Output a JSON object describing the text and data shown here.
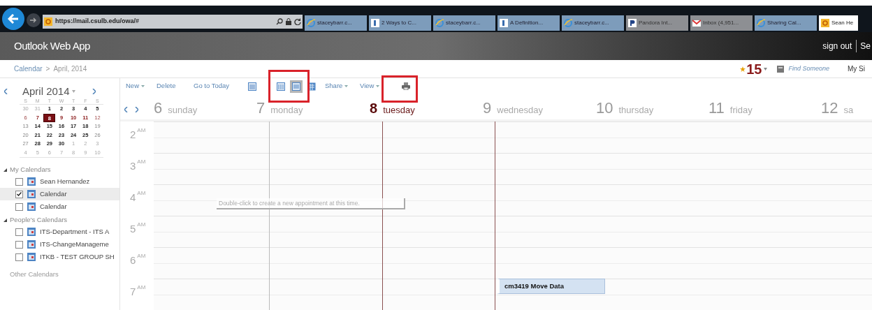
{
  "browser": {
    "address": "https://mail.csulb.edu/owa/#",
    "tabs": [
      {
        "label": "staceybarr.c...",
        "kind": "ie",
        "selected": false
      },
      {
        "label": "2 Ways to C...",
        "kind": "doc",
        "selected": false
      },
      {
        "label": "staceybarr.c...",
        "kind": "ie",
        "selected": false
      },
      {
        "label": "A Definition...",
        "kind": "doc",
        "selected": false
      },
      {
        "label": "staceybarr.c...",
        "kind": "ie",
        "selected": false
      },
      {
        "label": "Pandora Int...",
        "kind": "pandora",
        "selected": false
      },
      {
        "label": "Inbox (4,951...",
        "kind": "mail",
        "selected": false
      },
      {
        "label": "Sharing Cal...",
        "kind": "ie",
        "selected": false
      },
      {
        "label": "Sean He",
        "kind": "owa",
        "selected": true
      }
    ]
  },
  "app": {
    "title": "Outlook Web App",
    "sign_out": "sign out",
    "user": "Se"
  },
  "breadcrumb": {
    "root": "Calendar",
    "separator": ">",
    "current": "April, 2014"
  },
  "topbar": {
    "reminder_count": "15",
    "find_someone": "Find Someone",
    "my_site": "My Si"
  },
  "mini_calendar": {
    "title": "April 2014",
    "weekdays": [
      "S",
      "M",
      "T",
      "W",
      "T",
      "F",
      "S"
    ],
    "weeks": [
      [
        {
          "d": "30",
          "kind": "other"
        },
        {
          "d": "31",
          "kind": "other"
        },
        {
          "d": "1",
          "kind": "busy"
        },
        {
          "d": "2",
          "kind": "busy"
        },
        {
          "d": "3",
          "kind": "busy"
        },
        {
          "d": "4",
          "kind": "busy"
        },
        {
          "d": "5",
          "kind": "busy"
        }
      ],
      [
        {
          "d": "6",
          "kind": "weekfree"
        },
        {
          "d": "7",
          "kind": "weekbusy"
        },
        {
          "d": "8",
          "kind": "selected"
        },
        {
          "d": "9",
          "kind": "weekbusy"
        },
        {
          "d": "10",
          "kind": "weekbusy"
        },
        {
          "d": "11",
          "kind": "weekbusy"
        },
        {
          "d": "12",
          "kind": "weekfree"
        }
      ],
      [
        {
          "d": "13",
          "kind": "free"
        },
        {
          "d": "14",
          "kind": "busy"
        },
        {
          "d": "15",
          "kind": "busy"
        },
        {
          "d": "16",
          "kind": "busy"
        },
        {
          "d": "17",
          "kind": "busy"
        },
        {
          "d": "18",
          "kind": "busy"
        },
        {
          "d": "19",
          "kind": "free"
        }
      ],
      [
        {
          "d": "20",
          "kind": "free"
        },
        {
          "d": "21",
          "kind": "busy"
        },
        {
          "d": "22",
          "kind": "busy"
        },
        {
          "d": "23",
          "kind": "busy"
        },
        {
          "d": "24",
          "kind": "busy"
        },
        {
          "d": "25",
          "kind": "busy"
        },
        {
          "d": "26",
          "kind": "free"
        }
      ],
      [
        {
          "d": "27",
          "kind": "free"
        },
        {
          "d": "28",
          "kind": "busy"
        },
        {
          "d": "29",
          "kind": "busy"
        },
        {
          "d": "30",
          "kind": "busy"
        },
        {
          "d": "1",
          "kind": "other"
        },
        {
          "d": "2",
          "kind": "other"
        },
        {
          "d": "3",
          "kind": "other"
        }
      ],
      [
        {
          "d": "4",
          "kind": "other"
        },
        {
          "d": "5",
          "kind": "other"
        },
        {
          "d": "6",
          "kind": "other"
        },
        {
          "d": "7",
          "kind": "other"
        },
        {
          "d": "8",
          "kind": "other"
        },
        {
          "d": "9",
          "kind": "other"
        },
        {
          "d": "10",
          "kind": "other"
        }
      ]
    ]
  },
  "calendar_groups": [
    {
      "title": "My Calendars",
      "expanded": true,
      "items": [
        {
          "label": "Sean Hernandez",
          "checked": false,
          "selected": false
        },
        {
          "label": "Calendar",
          "checked": true,
          "selected": true
        },
        {
          "label": "Calendar",
          "checked": false,
          "selected": false
        }
      ]
    },
    {
      "title": "People's Calendars",
      "expanded": true,
      "items": [
        {
          "label": "ITS-Department - ITS A",
          "checked": false,
          "selected": false
        },
        {
          "label": "ITS-ChangeManageme",
          "checked": false,
          "selected": false
        },
        {
          "label": "ITKB - TEST GROUP SH",
          "checked": false,
          "selected": false
        }
      ]
    }
  ],
  "other_calendars_label": "Other Calendars",
  "toolbar": [
    {
      "kind": "menu",
      "label": "New"
    },
    {
      "kind": "link",
      "label": "Delete"
    },
    {
      "kind": "link",
      "label": "Go to Today"
    },
    {
      "kind": "dayview",
      "selected": false
    },
    {
      "kind": "workweekview",
      "selected": false
    },
    {
      "kind": "weekview",
      "selected": true
    },
    {
      "kind": "monthview",
      "selected": false
    },
    {
      "kind": "menu",
      "label": "Share"
    },
    {
      "kind": "menu",
      "label": "View"
    },
    {
      "kind": "print"
    }
  ],
  "days": [
    {
      "number": "6",
      "name": "sunday",
      "today": false
    },
    {
      "number": "7",
      "name": "monday",
      "today": false
    },
    {
      "number": "8",
      "name": "tuesday",
      "today": true
    },
    {
      "number": "9",
      "name": "wednesday",
      "today": false,
      "events": [
        {
          "title": "cm3419 Move Data"
        }
      ]
    },
    {
      "number": "10",
      "name": "thursday",
      "today": false
    },
    {
      "number": "11",
      "name": "friday",
      "today": false
    },
    {
      "number": "12",
      "name": "sa",
      "today": false
    }
  ],
  "hours": [
    {
      "hour": "2",
      "period": "AM"
    },
    {
      "hour": "3",
      "period": "AM"
    },
    {
      "hour": "4",
      "period": "AM"
    },
    {
      "hour": "5",
      "period": "AM"
    },
    {
      "hour": "6",
      "period": "AM"
    },
    {
      "hour": "7",
      "period": "AM"
    }
  ],
  "tooltip": "Double-click to create a new appointment at this time."
}
